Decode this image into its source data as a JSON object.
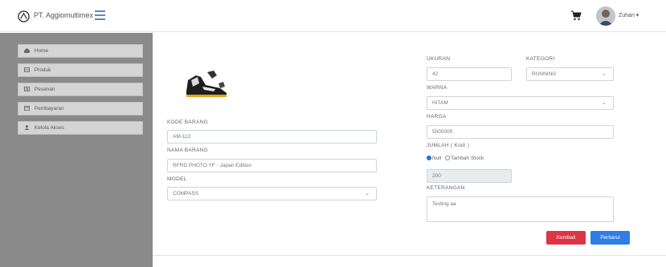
{
  "header": {
    "brand": "PT. Aggiomultimex",
    "user_name": "Zuhan ▾",
    "icons": {
      "logo": "logo-icon",
      "menu": "hamburger-icon",
      "cart": "cart-icon"
    }
  },
  "sidebar": {
    "items": [
      {
        "label": "Home",
        "icon": "home-icon"
      },
      {
        "label": "Produk",
        "icon": "product-icon"
      },
      {
        "label": "Pesanan",
        "icon": "order-icon"
      },
      {
        "label": "Pembayaran",
        "icon": "payment-icon"
      },
      {
        "label": "Kelola Akses",
        "icon": "user-icon"
      }
    ]
  },
  "form": {
    "kode_barang": {
      "label": "KODE BARANG",
      "value": "AM-112"
    },
    "nama_barang": {
      "label": "NAMA BARANG",
      "value": "RFRD PHOTO YF - Japan Edition"
    },
    "model": {
      "label": "MODEL",
      "value": "COMPASS"
    },
    "ukuran": {
      "label": "UKURAN",
      "value": "42"
    },
    "kategori": {
      "label": "KATEGORI",
      "value": "RUNNING"
    },
    "warna": {
      "label": "WARNA",
      "value": "HITAM"
    },
    "harga": {
      "label": "HARGA",
      "value": "5000000"
    },
    "jumlah": {
      "label": "JUMLAH ( Kodi )",
      "option_null": "Null",
      "option_add": "Tambah Stock",
      "selected": "Null",
      "value": "200"
    },
    "keterangan": {
      "label": "KETERANGAN",
      "value": "Testing aa"
    }
  },
  "buttons": {
    "back": "Kembali",
    "update": "Perbarui"
  },
  "colors": {
    "sidebar": "#8a8a8a",
    "danger": "#dc3545",
    "primary": "#2f7de8"
  }
}
